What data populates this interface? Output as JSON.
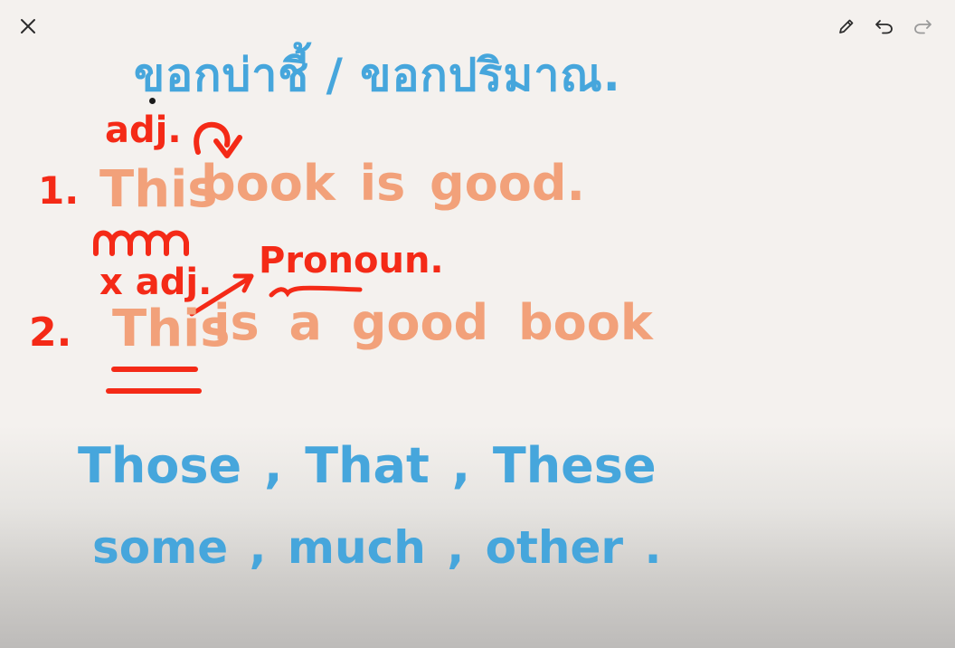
{
  "toolbar": {
    "close_icon": "close-icon",
    "pen_icon": "pencil-icon",
    "undo_icon": "undo-icon",
    "redo_icon": "redo-icon"
  },
  "colors": {
    "background": "#f4f1ee",
    "blue_ink": "#46a6dc",
    "orange_ink": "#f2a17a",
    "red_ink": "#f42a17",
    "icon_active": "#2b2b2b",
    "icon_disabled": "#9a9a9a"
  },
  "canvas": {
    "heading": "ขอกบ่าชี้ / ขอกปริมาณ.",
    "label_adj": "adj.",
    "line1_number": "1.",
    "line1_word_this": "This",
    "line1_rest": "book  is  good.",
    "label_not_adj": "x adj.",
    "label_pronoun": "Pronoun.",
    "line2_number": "2.",
    "line2_word_this": "This",
    "line2_rest": "is  a  good  book",
    "examples_line1": "Those , That , These",
    "examples_line2": "some , much , other ."
  }
}
